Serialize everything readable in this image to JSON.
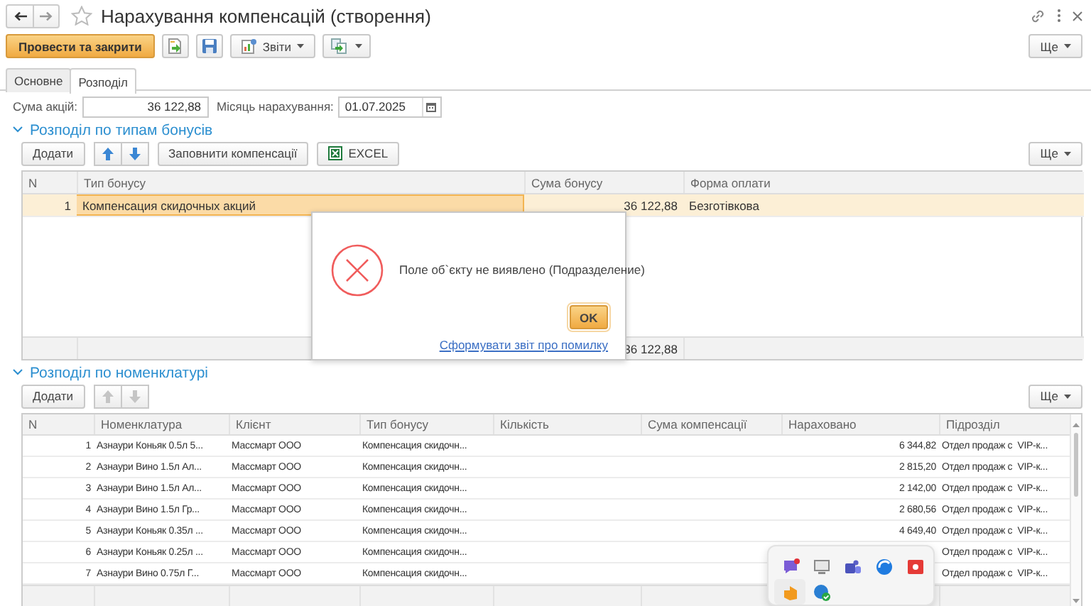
{
  "window": {
    "title": "Нарахування компенсацій (створення)"
  },
  "command_bar": {
    "post_button": "Провести та закрити",
    "reports_button": "Звіти",
    "more_button": "Ще"
  },
  "tabs": [
    {
      "label": "Основне",
      "selected": false
    },
    {
      "label": "Розподіл",
      "selected": true
    }
  ],
  "header_fields": [
    {
      "kind": "number",
      "label": "Сума акцій:",
      "value": "36 122,88"
    },
    {
      "kind": "date",
      "label": "Місяць нарахування:",
      "value": "01.07.2025"
    }
  ],
  "bonus_types": {
    "title": "Розподіл по типам бонусів",
    "expanded": true,
    "add_button": "Додати",
    "move_buttons": {
      "disabled": false
    },
    "fill_button": "Заповнити компенсації",
    "excel_button": "EXCEL",
    "more_button": "Ще",
    "table": {
      "columns": [
        "N",
        "Тип бонусу",
        "Сума бонусу",
        "Форма оплати"
      ],
      "rows": [
        {
          "selected": true,
          "n": "1",
          "bonus_type": "Компенсация скидочных акций",
          "amount": "36 122,88",
          "payment_form": "Безготівкова"
        }
      ],
      "footer": {
        "amount": "36 122,88"
      }
    }
  },
  "nomenclature": {
    "title": "Розподіл по номенклатурі",
    "expanded": true,
    "add_button": "Додати",
    "move_buttons": {
      "disabled": true
    },
    "more_button": "Ще",
    "table": {
      "columns": [
        "N",
        "Номенклатура",
        "Клієнт",
        "Тип бонусу",
        "Кількість",
        "Сума компенсації",
        "Нараховано",
        "Підрозділ"
      ],
      "rows": [
        {
          "n": "1",
          "item": "Азнаури Коньяк 0.5л 5...",
          "client": "Массмарт ООО",
          "bonus_type": "Компенсация скидочн...",
          "accrued": "6 344,82",
          "department": "Отдел продаж с  VIP-к..."
        },
        {
          "n": "2",
          "item": "Азнаури Вино 1.5л Ал...",
          "client": "Массмарт ООО",
          "bonus_type": "Компенсация скидочн...",
          "accrued": "2 815,20",
          "department": "Отдел продаж с  VIP-к..."
        },
        {
          "n": "3",
          "item": "Азнаури Вино 1.5л Ал...",
          "client": "Массмарт ООО",
          "bonus_type": "Компенсация скидочн...",
          "accrued": "2 142,00",
          "department": "Отдел продаж с  VIP-к..."
        },
        {
          "n": "4",
          "item": "Азнаури Вино 1.5л Гр...",
          "client": "Массмарт ООО",
          "bonus_type": "Компенсация скидочн...",
          "accrued": "2 680,56",
          "department": "Отдел продаж с  VIP-к..."
        },
        {
          "n": "5",
          "item": "Азнаури Коньяк 0.35л ...",
          "client": "Массмарт ООО",
          "bonus_type": "Компенсация скидочн...",
          "accrued": "4 649,40",
          "department": "Отдел продаж с  VIP-к..."
        },
        {
          "n": "6",
          "item": "Азнаури Коньяк 0.25л ...",
          "client": "Массмарт ООО",
          "bonus_type": "Компенсация скидочн...",
          "department": "Отдел продаж с  VIP-к..."
        },
        {
          "n": "7",
          "item": "Азнаури Вино 0.75л Г...",
          "client": "Массмарт ООО",
          "bonus_type": "Компенсация скидочн...",
          "department": "Отдел продаж с  VIP-к..."
        }
      ]
    }
  },
  "dialog": {
    "message": "Поле об`єкту не виявлено (Подразделение)",
    "ok_button": "OK",
    "report_link": "Сформувати звіт про помилку"
  }
}
